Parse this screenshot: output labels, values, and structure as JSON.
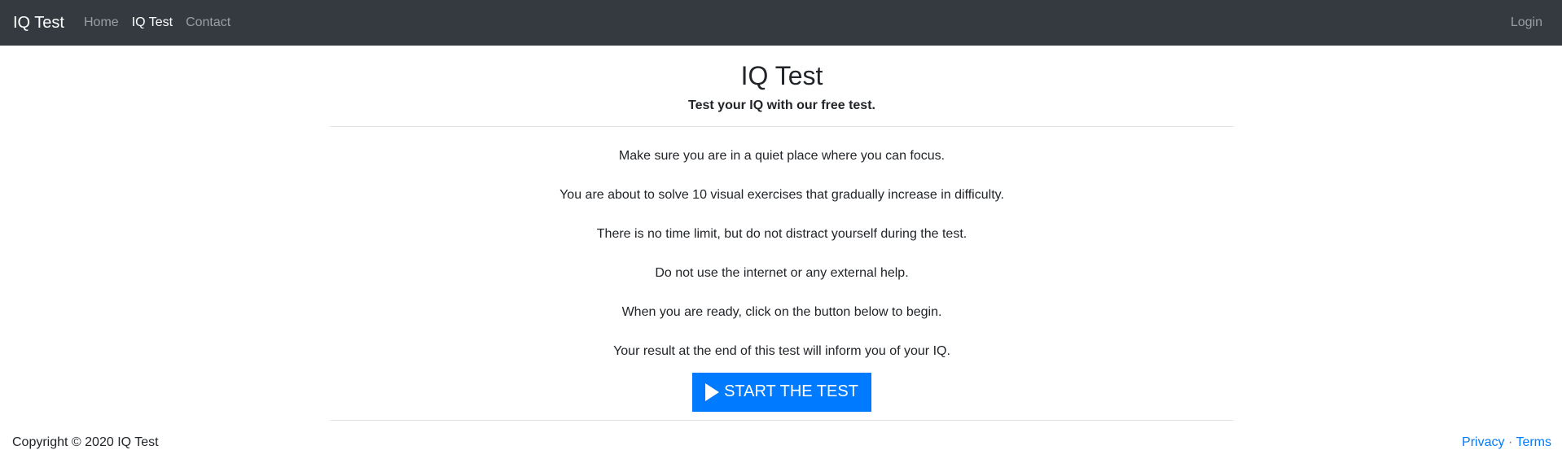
{
  "navbar": {
    "brand": "IQ Test",
    "items": [
      {
        "label": "Home",
        "active": false
      },
      {
        "label": "IQ Test",
        "active": true
      },
      {
        "label": "Contact",
        "active": false
      }
    ],
    "login_label": "Login"
  },
  "main": {
    "title": "IQ Test",
    "subtitle": "Test your IQ with our free test.",
    "instructions": [
      "Make sure you are in a quiet place where you can focus.",
      "You are about to solve 10 visual exercises that gradually increase in difficulty.",
      "There is no time limit, but do not distract yourself during the test.",
      "Do not use the internet or any external help.",
      "When you are ready, click on the button below to begin.",
      "Your result at the end of this test will inform you of your IQ."
    ],
    "start_button_label": "START THE TEST",
    "start_button_icon": "play-icon"
  },
  "footer": {
    "copyright": "Copyright © 2020 IQ Test",
    "privacy_label": "Privacy",
    "separator": "·",
    "terms_label": "Terms"
  },
  "colors": {
    "navbar_bg": "#343a40",
    "primary": "#007bff",
    "text": "#212529",
    "divider": "#dee2e6"
  }
}
